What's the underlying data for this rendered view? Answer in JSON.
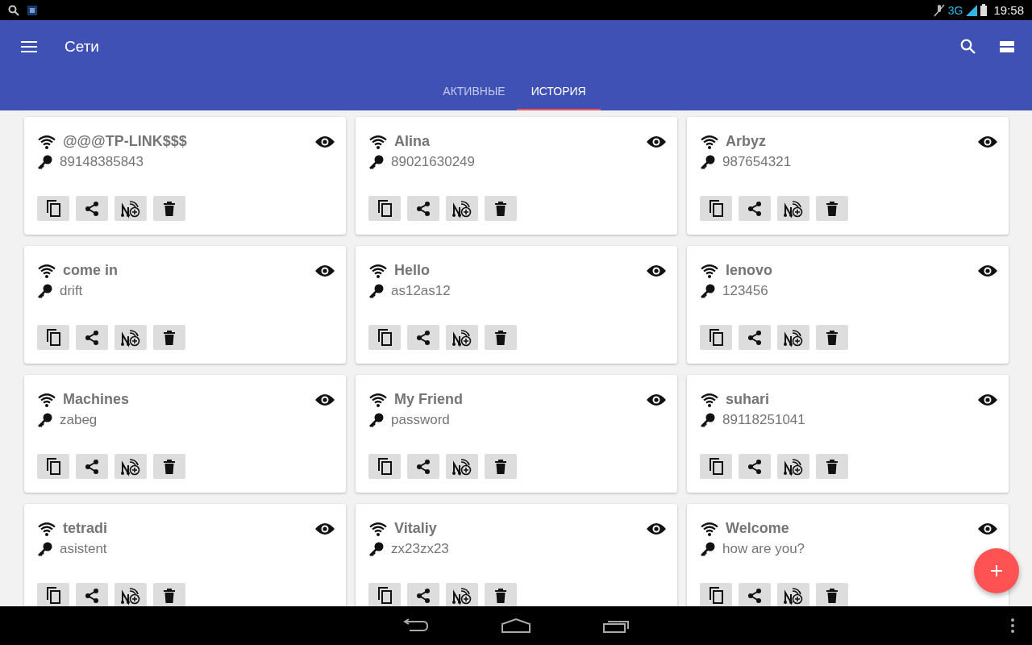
{
  "status_bar": {
    "network": "3G",
    "time": "19:58"
  },
  "app_bar": {
    "title": "Сети"
  },
  "tabs": [
    {
      "label": "АКТИВНЫЕ",
      "selected": false
    },
    {
      "label": "ИСТОРИЯ",
      "selected": true
    }
  ],
  "networks": [
    {
      "ssid": "@@@TP-LINK$$$",
      "password": "89148385843"
    },
    {
      "ssid": "Alina",
      "password": "89021630249"
    },
    {
      "ssid": "Arbyz",
      "password": "987654321"
    },
    {
      "ssid": "come in",
      "password": "drift"
    },
    {
      "ssid": "Hello",
      "password": "as12as12"
    },
    {
      "ssid": "lenovo",
      "password": "123456"
    },
    {
      "ssid": "Machines",
      "password": "zabeg"
    },
    {
      "ssid": "My Friend",
      "password": "password"
    },
    {
      "ssid": "suhari",
      "password": "89118251041"
    },
    {
      "ssid": "tetradi",
      "password": "asistent"
    },
    {
      "ssid": "Vitaliy",
      "password": "zx23zx23"
    },
    {
      "ssid": "Welcome",
      "password": "how are you?"
    }
  ]
}
